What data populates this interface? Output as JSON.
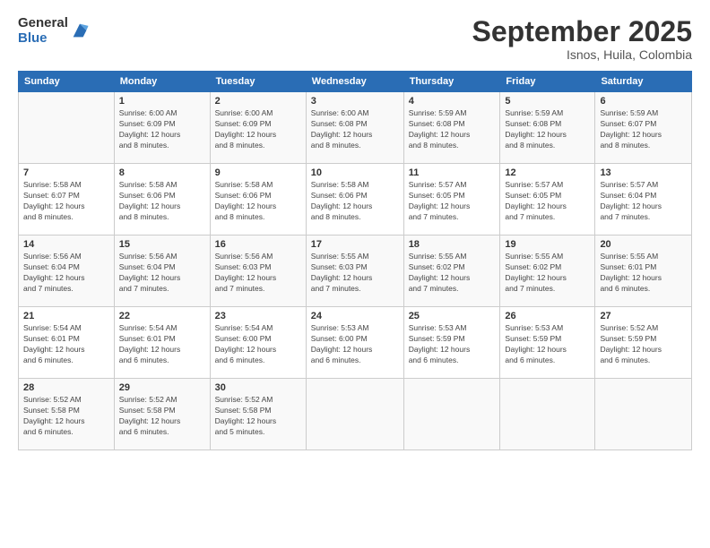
{
  "logo": {
    "general": "General",
    "blue": "Blue"
  },
  "title": "September 2025",
  "location": "Isnos, Huila, Colombia",
  "days_of_week": [
    "Sunday",
    "Monday",
    "Tuesday",
    "Wednesday",
    "Thursday",
    "Friday",
    "Saturday"
  ],
  "weeks": [
    [
      {
        "day": "",
        "detail": ""
      },
      {
        "day": "1",
        "detail": "Sunrise: 6:00 AM\nSunset: 6:09 PM\nDaylight: 12 hours\nand 8 minutes."
      },
      {
        "day": "2",
        "detail": "Sunrise: 6:00 AM\nSunset: 6:09 PM\nDaylight: 12 hours\nand 8 minutes."
      },
      {
        "day": "3",
        "detail": "Sunrise: 6:00 AM\nSunset: 6:08 PM\nDaylight: 12 hours\nand 8 minutes."
      },
      {
        "day": "4",
        "detail": "Sunrise: 5:59 AM\nSunset: 6:08 PM\nDaylight: 12 hours\nand 8 minutes."
      },
      {
        "day": "5",
        "detail": "Sunrise: 5:59 AM\nSunset: 6:08 PM\nDaylight: 12 hours\nand 8 minutes."
      },
      {
        "day": "6",
        "detail": "Sunrise: 5:59 AM\nSunset: 6:07 PM\nDaylight: 12 hours\nand 8 minutes."
      }
    ],
    [
      {
        "day": "7",
        "detail": "Sunrise: 5:58 AM\nSunset: 6:07 PM\nDaylight: 12 hours\nand 8 minutes."
      },
      {
        "day": "8",
        "detail": "Sunrise: 5:58 AM\nSunset: 6:06 PM\nDaylight: 12 hours\nand 8 minutes."
      },
      {
        "day": "9",
        "detail": "Sunrise: 5:58 AM\nSunset: 6:06 PM\nDaylight: 12 hours\nand 8 minutes."
      },
      {
        "day": "10",
        "detail": "Sunrise: 5:58 AM\nSunset: 6:06 PM\nDaylight: 12 hours\nand 8 minutes."
      },
      {
        "day": "11",
        "detail": "Sunrise: 5:57 AM\nSunset: 6:05 PM\nDaylight: 12 hours\nand 7 minutes."
      },
      {
        "day": "12",
        "detail": "Sunrise: 5:57 AM\nSunset: 6:05 PM\nDaylight: 12 hours\nand 7 minutes."
      },
      {
        "day": "13",
        "detail": "Sunrise: 5:57 AM\nSunset: 6:04 PM\nDaylight: 12 hours\nand 7 minutes."
      }
    ],
    [
      {
        "day": "14",
        "detail": "Sunrise: 5:56 AM\nSunset: 6:04 PM\nDaylight: 12 hours\nand 7 minutes."
      },
      {
        "day": "15",
        "detail": "Sunrise: 5:56 AM\nSunset: 6:04 PM\nDaylight: 12 hours\nand 7 minutes."
      },
      {
        "day": "16",
        "detail": "Sunrise: 5:56 AM\nSunset: 6:03 PM\nDaylight: 12 hours\nand 7 minutes."
      },
      {
        "day": "17",
        "detail": "Sunrise: 5:55 AM\nSunset: 6:03 PM\nDaylight: 12 hours\nand 7 minutes."
      },
      {
        "day": "18",
        "detail": "Sunrise: 5:55 AM\nSunset: 6:02 PM\nDaylight: 12 hours\nand 7 minutes."
      },
      {
        "day": "19",
        "detail": "Sunrise: 5:55 AM\nSunset: 6:02 PM\nDaylight: 12 hours\nand 7 minutes."
      },
      {
        "day": "20",
        "detail": "Sunrise: 5:55 AM\nSunset: 6:01 PM\nDaylight: 12 hours\nand 6 minutes."
      }
    ],
    [
      {
        "day": "21",
        "detail": "Sunrise: 5:54 AM\nSunset: 6:01 PM\nDaylight: 12 hours\nand 6 minutes."
      },
      {
        "day": "22",
        "detail": "Sunrise: 5:54 AM\nSunset: 6:01 PM\nDaylight: 12 hours\nand 6 minutes."
      },
      {
        "day": "23",
        "detail": "Sunrise: 5:54 AM\nSunset: 6:00 PM\nDaylight: 12 hours\nand 6 minutes."
      },
      {
        "day": "24",
        "detail": "Sunrise: 5:53 AM\nSunset: 6:00 PM\nDaylight: 12 hours\nand 6 minutes."
      },
      {
        "day": "25",
        "detail": "Sunrise: 5:53 AM\nSunset: 5:59 PM\nDaylight: 12 hours\nand 6 minutes."
      },
      {
        "day": "26",
        "detail": "Sunrise: 5:53 AM\nSunset: 5:59 PM\nDaylight: 12 hours\nand 6 minutes."
      },
      {
        "day": "27",
        "detail": "Sunrise: 5:52 AM\nSunset: 5:59 PM\nDaylight: 12 hours\nand 6 minutes."
      }
    ],
    [
      {
        "day": "28",
        "detail": "Sunrise: 5:52 AM\nSunset: 5:58 PM\nDaylight: 12 hours\nand 6 minutes."
      },
      {
        "day": "29",
        "detail": "Sunrise: 5:52 AM\nSunset: 5:58 PM\nDaylight: 12 hours\nand 6 minutes."
      },
      {
        "day": "30",
        "detail": "Sunrise: 5:52 AM\nSunset: 5:58 PM\nDaylight: 12 hours\nand 5 minutes."
      },
      {
        "day": "",
        "detail": ""
      },
      {
        "day": "",
        "detail": ""
      },
      {
        "day": "",
        "detail": ""
      },
      {
        "day": "",
        "detail": ""
      }
    ]
  ]
}
